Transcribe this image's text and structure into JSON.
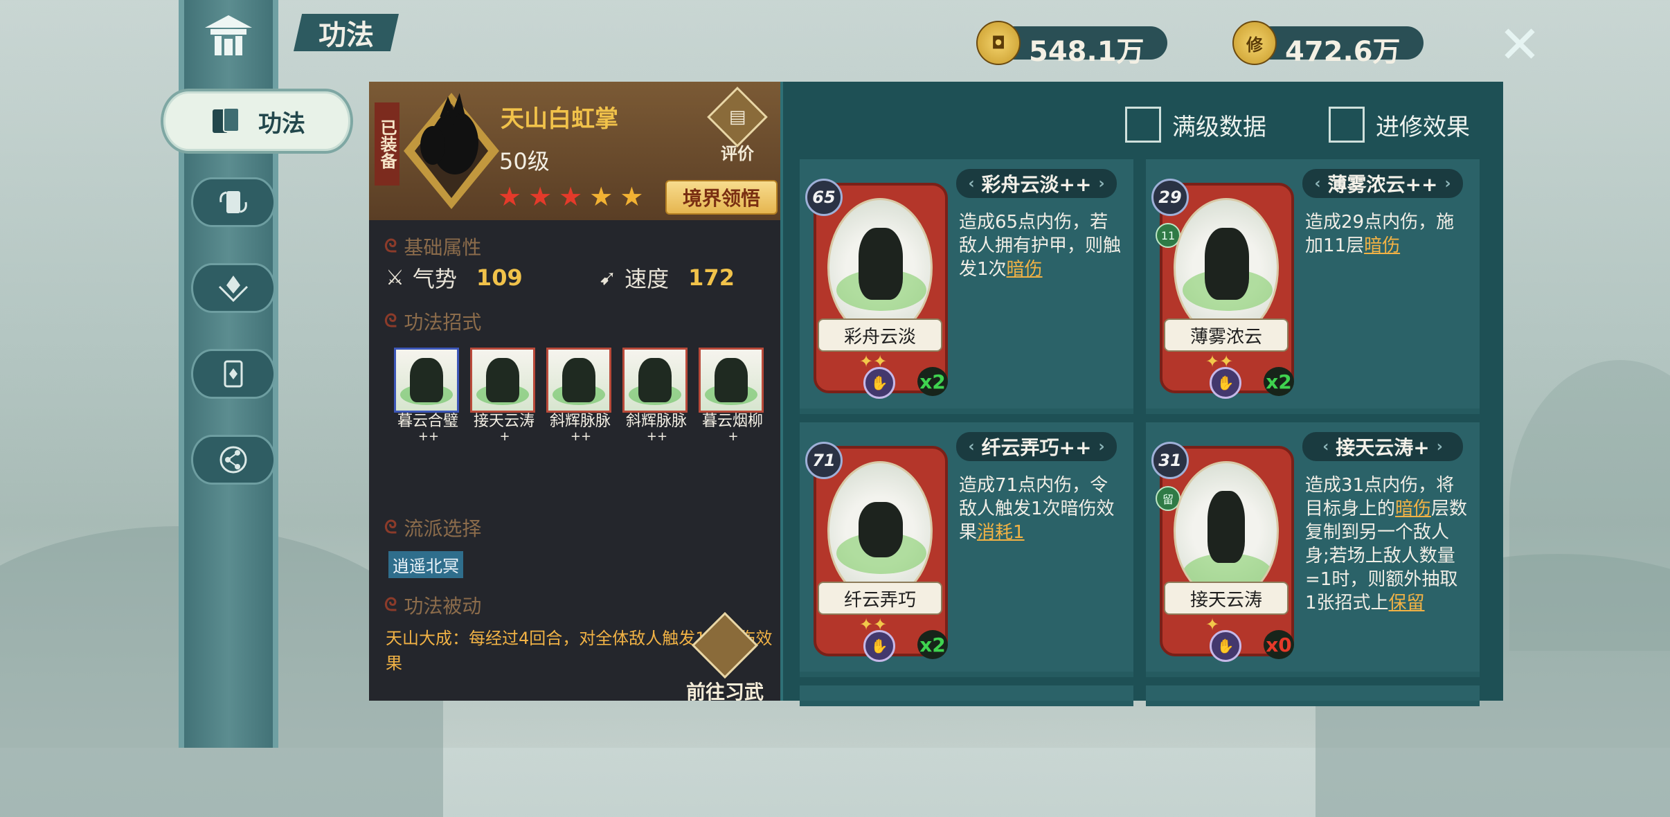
{
  "header": {
    "title": "功法"
  },
  "nav": {
    "active_label": "功法",
    "items": [
      "book-icon",
      "card-flip-icon",
      "emblem-icon",
      "card-icon",
      "share-icon"
    ]
  },
  "currency": [
    {
      "icon": "coin-icon",
      "symbol": "",
      "value": "548.1万"
    },
    {
      "icon": "cultivation-icon",
      "symbol": "修",
      "value": "472.6万"
    }
  ],
  "skill": {
    "equipped": "已装备",
    "name": "天山白虹掌",
    "level": "50级",
    "rate_label": "评价",
    "stars": 5,
    "realm_button": "境界领悟",
    "section_basic": "基础属性",
    "stats": [
      {
        "label": "气势",
        "value": "109"
      },
      {
        "label": "速度",
        "value": "172"
      }
    ],
    "section_moves": "功法招式",
    "moves": [
      {
        "name": "暮云合璧",
        "plus": "++"
      },
      {
        "name": "接天云涛",
        "plus": "+"
      },
      {
        "name": "斜辉脉脉",
        "plus": "++"
      },
      {
        "name": "斜辉脉脉",
        "plus": "++"
      },
      {
        "name": "暮云烟柳",
        "plus": "+"
      }
    ],
    "section_school": "流派选择",
    "school_tag": "逍遥北冥",
    "section_passive": "功法被动",
    "passive_text": "天山大成：每经过4回合，对全体敌人触发1次暗伤效果",
    "go_button": "前往习武"
  },
  "options": {
    "max_level": "满级数据",
    "advanced": "进修效果"
  },
  "cards": [
    {
      "title": "彩舟云淡++",
      "card_name": "彩舟云淡",
      "cost": "65",
      "plus": "✦✦",
      "count": "x2",
      "count_color": "#3fd34f",
      "badge": "",
      "desc_pre": "造成65点内伤，若敌人拥有护甲，则触发1次",
      "desc_link": "暗伤",
      "desc_post": ""
    },
    {
      "title": "薄雾浓云++",
      "card_name": "薄雾浓云",
      "cost": "29",
      "plus": "✦✦",
      "count": "x2",
      "count_color": "#3fd34f",
      "badge": "11",
      "desc_pre": "造成29点内伤，施加11层",
      "desc_link": "暗伤",
      "desc_post": ""
    },
    {
      "title": "纤云弄巧++",
      "card_name": "纤云弄巧",
      "cost": "71",
      "plus": "✦✦",
      "count": "x2",
      "count_color": "#3fd34f",
      "badge": "",
      "desc_pre": "造成71点内伤，令敌人触发1次暗伤效果",
      "desc_link": "消耗1",
      "desc_post": ""
    },
    {
      "title": "接天云涛+",
      "card_name": "接天云涛",
      "cost": "31",
      "plus": "✦",
      "count": "x0",
      "count_color": "#e53a2a",
      "badge": "留",
      "desc_pre": "造成31点内伤，将目标身上的",
      "desc_link": "暗伤",
      "desc_post": "层数复制到另一个敌人身;若场上敌人数量=1时，则额外抽取1张招式上",
      "desc_link2": "保留"
    }
  ]
}
